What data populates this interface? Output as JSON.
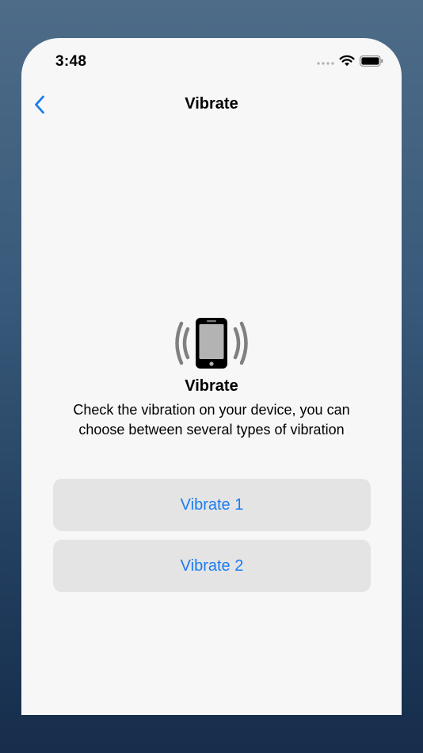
{
  "status_bar": {
    "time": "3:48",
    "icons": [
      "signal-dots-icon",
      "wifi-icon",
      "battery-icon"
    ]
  },
  "nav": {
    "back_icon": "chevron-left-icon",
    "title": "Vibrate"
  },
  "content": {
    "icon": "phone-vibrate-icon",
    "heading": "Vibrate",
    "description": "Check the vibration on your device, you can choose between several types of vibration"
  },
  "buttons": [
    {
      "label": "Vibrate 1"
    },
    {
      "label": "Vibrate 2"
    }
  ],
  "colors": {
    "accent": "#1a7cf0",
    "screen_bg": "#f7f7f7",
    "button_bg": "#e4e4e4"
  }
}
